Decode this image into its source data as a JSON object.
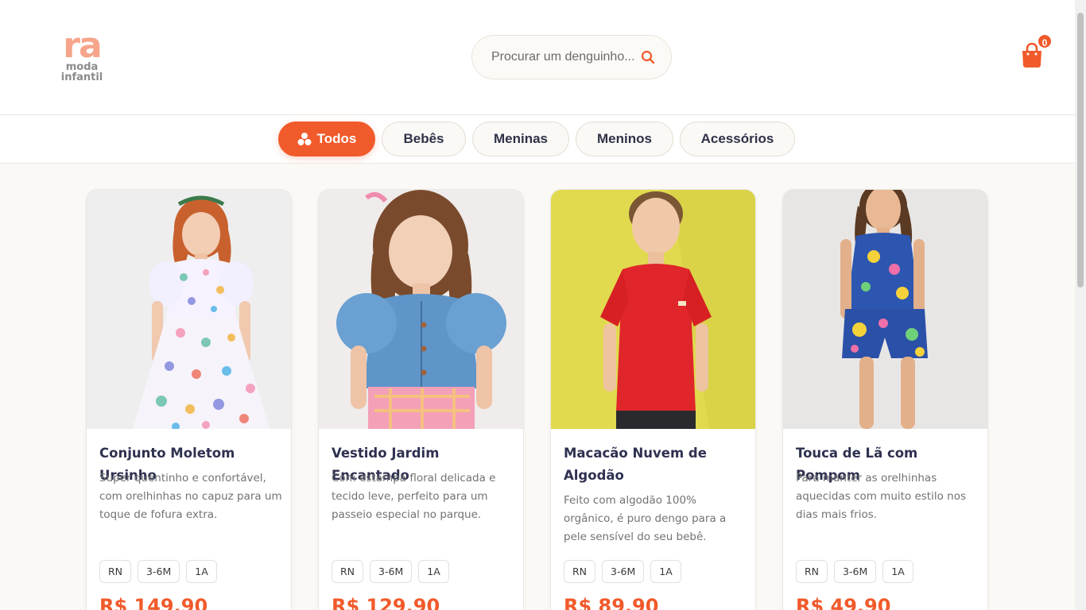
{
  "brand": {
    "logo_mark": "ra",
    "logo_line1": "moda",
    "logo_line2": "infantil",
    "accent_color": "#f15a2b",
    "logo_color": "#f6a48a"
  },
  "header": {
    "search_placeholder": "Procurar um denguinho...",
    "search_icon": "search-icon",
    "cart_icon": "shopping-bag-icon",
    "cart_count": "0"
  },
  "categories": [
    {
      "label": "Todos",
      "active": true,
      "icon": "shapes-icon"
    },
    {
      "label": "Bebês",
      "active": false
    },
    {
      "label": "Meninas",
      "active": false
    },
    {
      "label": "Meninos",
      "active": false
    },
    {
      "label": "Acessórios",
      "active": false
    }
  ],
  "products": [
    {
      "title": "Conjunto Moletom Ursinho",
      "description": "Super quentinho e confortável, com orelhinhas no capuz para um toque de fofura extra.",
      "sizes": [
        "RN",
        "3-6M",
        "1A"
      ],
      "price": "R$ 149,90",
      "image": "girl-in-printed-dress-photo"
    },
    {
      "title": "Vestido Jardim Encantado",
      "description": "Com estampa floral delicada e tecido leve, perfeito para um passeio especial no parque.",
      "sizes": [
        "RN",
        "3-6M",
        "1A"
      ],
      "price": "R$ 129,90",
      "image": "girl-in-denim-shirt-photo"
    },
    {
      "title": "Macacão Nuvem de Algodão",
      "description": "Feito com algodão 100% orgânico, é puro dengo para a pele sensível do seu bebê.",
      "sizes": [
        "RN",
        "3-6M",
        "1A"
      ],
      "price": "R$ 89,90",
      "image": "boy-in-red-tshirt-photo"
    },
    {
      "title": "Touca de Lã com Pompom",
      "description": "Para manter as orelhinhas aquecidas com muito estilo nos dias mais frios.",
      "sizes": [
        "RN",
        "3-6M",
        "1A"
      ],
      "price": "R$ 49,90",
      "image": "girl-in-floral-set-photo"
    }
  ]
}
